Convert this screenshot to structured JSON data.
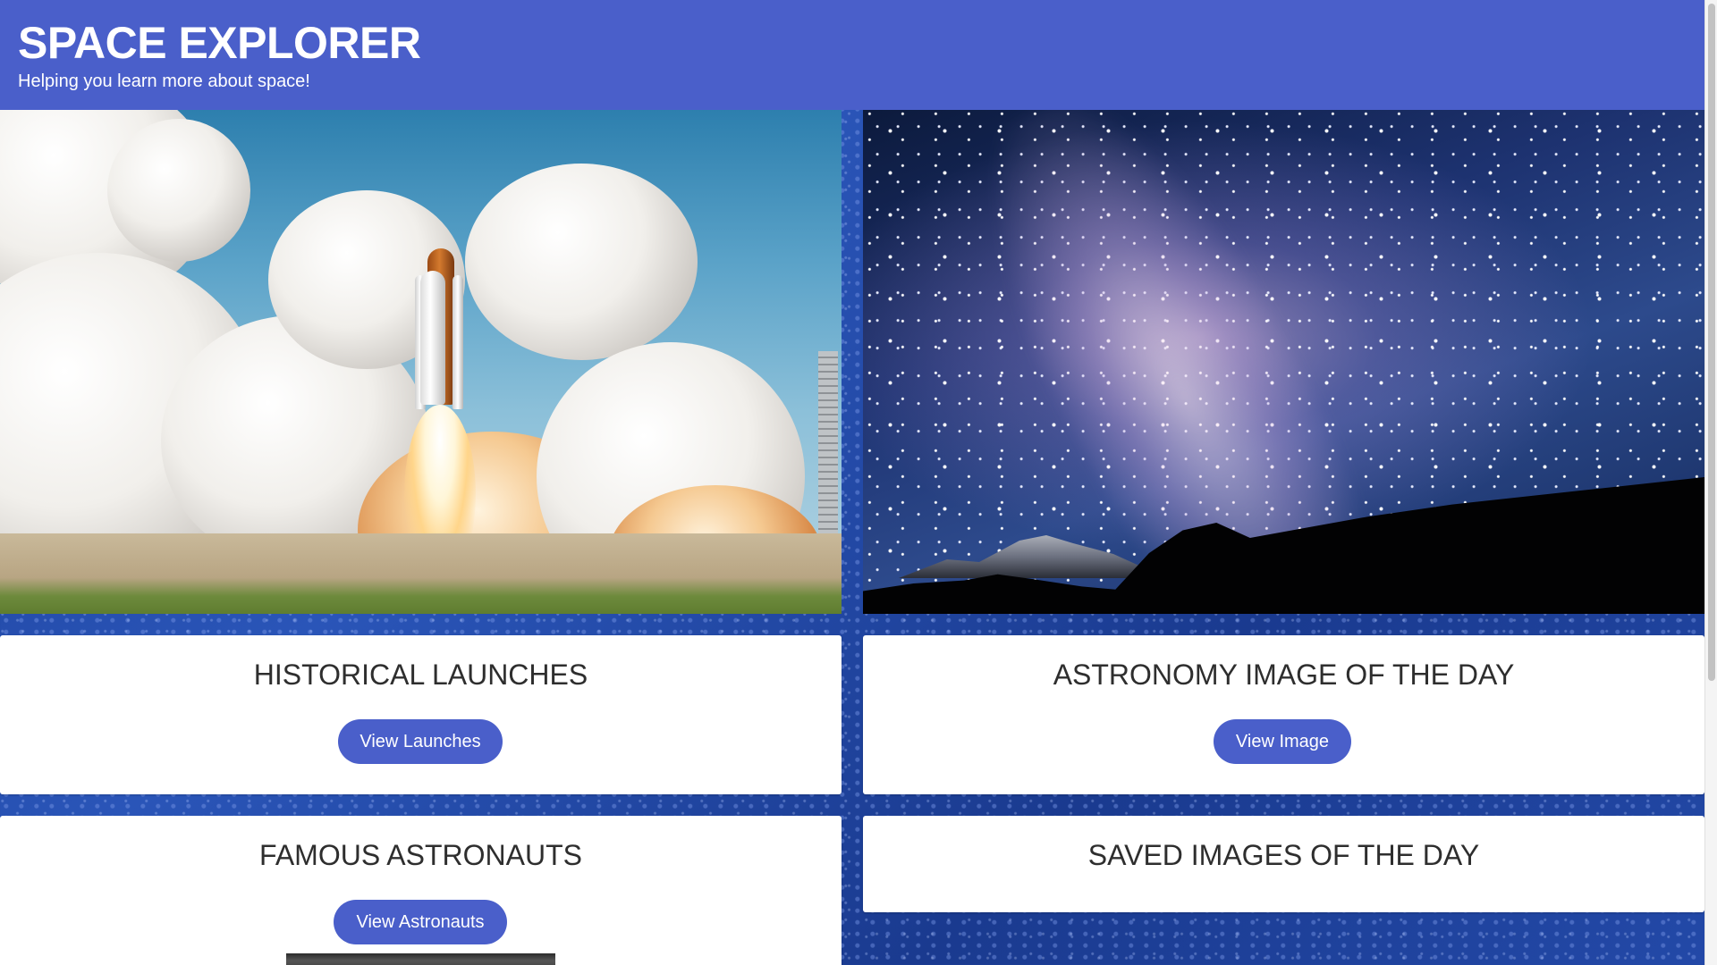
{
  "header": {
    "title": "SPACE EXPLORER",
    "subtitle": "Helping you learn more about space!"
  },
  "sections": [
    {
      "title": "HISTORICAL LAUNCHES",
      "button_label": "View Launches"
    },
    {
      "title": "ASTRONOMY IMAGE OF THE DAY",
      "button_label": "View Image"
    },
    {
      "title": "FAMOUS ASTRONAUTS",
      "button_label": "View Astronauts"
    },
    {
      "title": "SAVED IMAGES OF THE DAY"
    }
  ],
  "colors": {
    "brand": "#4a5fca",
    "card_background": "#ffffff",
    "heading_text": "#2e2e2e"
  }
}
